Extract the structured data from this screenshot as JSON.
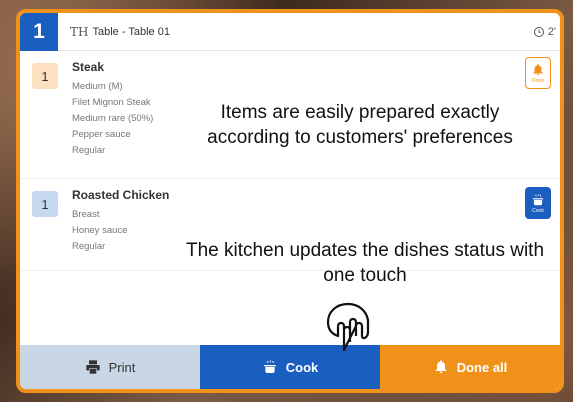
{
  "order": {
    "number": "1",
    "table_icon": "TH",
    "table_label": "Table - Table 01",
    "timer": "2'"
  },
  "items": [
    {
      "qty": "1",
      "name": "Steak",
      "modifiers": [
        "Medium (M)",
        "Filet Mignon Steak",
        "Medium rare (50%)",
        "Pepper sauce",
        "Regular"
      ],
      "status_label": "Done",
      "status_icon": "bell-icon"
    },
    {
      "qty": "1",
      "name": "Roasted Chicken",
      "modifiers": [
        "Breast",
        "Honey sauce",
        "Regular"
      ],
      "status_label": "Cook",
      "status_icon": "cooking-pot-icon"
    }
  ],
  "overlay": {
    "caption1": "Items are easily prepared exactly according to customers' preferences",
    "caption2": "The kitchen updates the dishes status with one touch"
  },
  "footer": {
    "print_label": "Print",
    "cook_label": "Cook",
    "done_all_label": "Done all"
  },
  "colors": {
    "accent": "#f0921a",
    "primary": "#1a5fc0",
    "print_bg": "#c8d6e6"
  }
}
